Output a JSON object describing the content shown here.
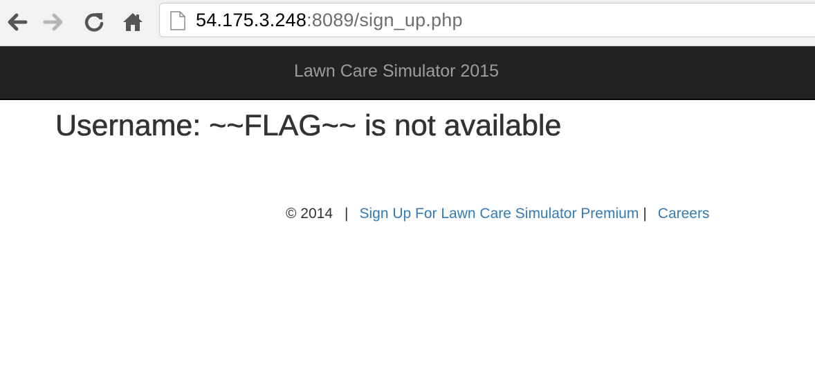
{
  "browser": {
    "url_host": "54.175.3.248",
    "url_path": ":8089/sign_up.php",
    "icons": {
      "back": "back-arrow-icon",
      "forward": "forward-arrow-icon",
      "reload": "reload-icon",
      "home": "home-icon",
      "page": "page-icon"
    }
  },
  "navbar": {
    "brand": "Lawn Care Simulator 2015"
  },
  "main": {
    "message": "Username: ~~FLAG~~ is not available"
  },
  "footer": {
    "copyright": "© 2014",
    "separator": "|",
    "premium_link": "Sign Up For Lawn Care Simulator Premium",
    "careers_link": "Careers"
  },
  "colors": {
    "navbar_bg": "#222222",
    "brand_text": "#9d9d9d",
    "link": "#337ab7",
    "text": "#333333"
  }
}
